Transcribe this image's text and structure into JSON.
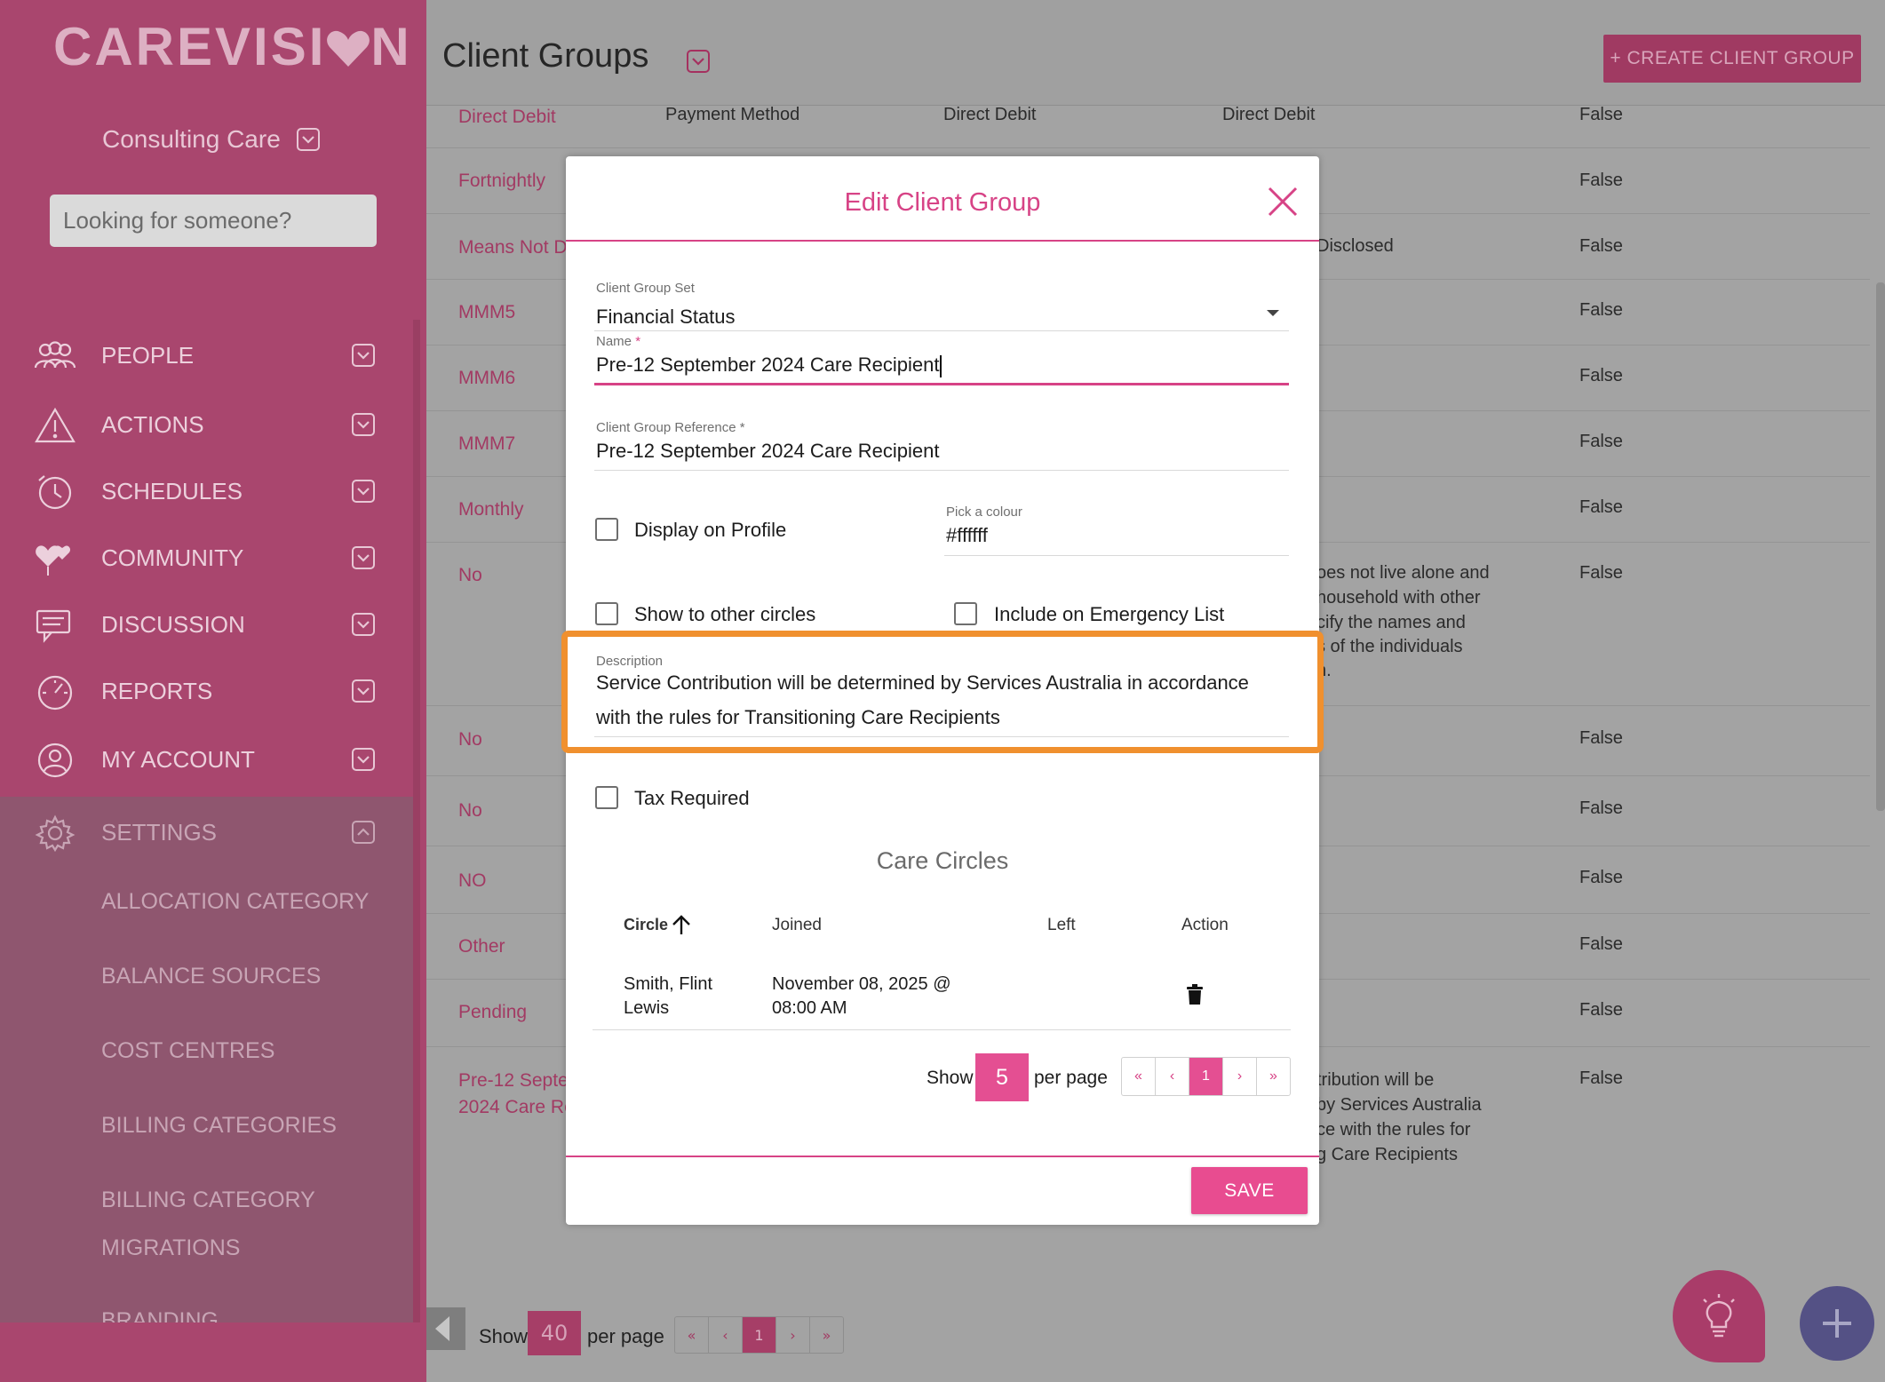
{
  "sidebar": {
    "logo_text": "CAREVISI N",
    "org_name": "Consulting Care",
    "search_placeholder": "Looking for someone?",
    "nav": [
      {
        "label": "PEOPLE",
        "icon": "people-icon"
      },
      {
        "label": "ACTIONS",
        "icon": "warning-icon"
      },
      {
        "label": "SCHEDULES",
        "icon": "clock-icon"
      },
      {
        "label": "COMMUNITY",
        "icon": "hearts-icon"
      },
      {
        "label": "DISCUSSION",
        "icon": "chat-icon"
      },
      {
        "label": "REPORTS",
        "icon": "gauge-icon"
      },
      {
        "label": "MY ACCOUNT",
        "icon": "user-icon"
      }
    ],
    "settings": {
      "label": "SETTINGS",
      "items": [
        "ALLOCATION CATEGORY",
        "BALANCE SOURCES",
        "COST CENTRES",
        "BILLING CATEGORIES",
        "BILLING CATEGORY",
        "MIGRATIONS",
        "BRANDING"
      ]
    }
  },
  "main": {
    "title": "Client Groups",
    "create_button": "+ CREATE CLIENT GROUP",
    "rows": [
      {
        "name": "Direct Debit",
        "set": "Payment Method",
        "ref": "Direct Debit",
        "desc": "Direct Debit",
        "flag": "False"
      },
      {
        "name": "Fortnightly",
        "flag": "False"
      },
      {
        "name": "Means Not Di",
        "desc": "Disclosed",
        "flag": "False"
      },
      {
        "name": "MMM5",
        "flag": "False"
      },
      {
        "name": "MMM6",
        "flag": "False"
      },
      {
        "name": "MMM7",
        "flag": "False"
      },
      {
        "name": "Monthly",
        "flag": "False"
      },
      {
        "name": "No",
        "desc1": "oes not live alone and",
        "desc2": "household with other",
        "desc3": "cify the names and",
        "desc4": "s of the individuals",
        "desc5": "h.",
        "flag": "False"
      },
      {
        "name": "No",
        "flag": "False"
      },
      {
        "name": "No",
        "flag": "False"
      },
      {
        "name": "NO",
        "flag": "False"
      },
      {
        "name": "Other",
        "flag": "False"
      },
      {
        "name": "Pending",
        "flag": "False"
      },
      {
        "name1": "Pre-12 Septer",
        "name2": "2024 Care Re",
        "desc1": "tribution will be",
        "desc2": "by Services Australia",
        "desc3": "ce with the rules for",
        "desc4": "g Care Recipients",
        "flag": "False"
      }
    ],
    "pagination": {
      "show_label": "Show",
      "per_page": "40",
      "per_page_label": "per page",
      "first": "«",
      "prev": "‹",
      "page": "1",
      "next": "›",
      "last": "»"
    }
  },
  "modal": {
    "title": "Edit Client Group",
    "client_group_set_label": "Client Group Set",
    "client_group_set_value": "Financial Status",
    "name_label": "Name",
    "name_value": "Pre-12 September 2024 Care Recipient",
    "reference_label": "Client Group Reference",
    "reference_value": "Pre-12 September 2024 Care Recipient",
    "required_mark": "*",
    "display_on_profile": "Display on Profile",
    "colour_label": "Pick a colour",
    "colour_value": "#ffffff",
    "show_to_other_circles": "Show to other circles",
    "include_emergency": "Include on Emergency List",
    "description_label": "Description",
    "description_line1": "Service Contribution will be determined by Services Australia in accordance",
    "description_line2": "with the rules for Transitioning Care Recipients",
    "tax_required": "Tax Required",
    "care_circles_title": "Care Circles",
    "table_headers": {
      "circle": "Circle",
      "joined": "Joined",
      "left": "Left",
      "action": "Action"
    },
    "table_rows": [
      {
        "circle_line1": "Smith, Flint",
        "circle_line2": "Lewis",
        "joined_line1": "November 08, 2025 @",
        "joined_line2": "08:00 AM",
        "left": ""
      }
    ],
    "pagination": {
      "show_label": "Show",
      "per_page": "5",
      "per_page_label": "per page",
      "first": "«",
      "prev": "‹",
      "page": "1",
      "next": "›",
      "last": "»"
    },
    "save_button": "SAVE"
  },
  "colors": {
    "brand": "#e84c90",
    "sidebar": "#a9466e",
    "highlight": "#f0902e",
    "overlay_fab": "#545185"
  }
}
